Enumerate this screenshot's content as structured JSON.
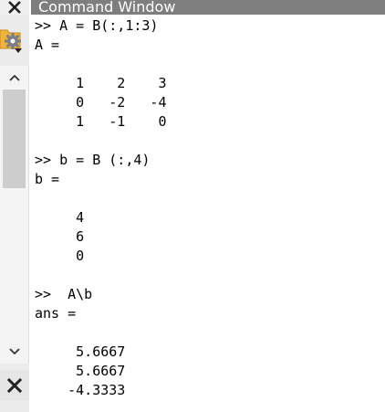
{
  "window": {
    "title": "Command Window"
  },
  "icons": {
    "close_top": "close-icon",
    "gear": "gear-icon",
    "folder": "folder-icon",
    "scroll_up": "chevron-up-icon",
    "scroll_down": "chevron-down-icon",
    "close_bottom": "close-icon"
  },
  "colors": {
    "titlebar_bg": "#7e7e7e",
    "titlebar_text": "#ffffff",
    "folder": "#f0b43c"
  },
  "console": {
    "lines": [
      ">> A = B(:,1:3)",
      "A =",
      "",
      "     1    2    3",
      "     0   -2   -4",
      "     1   -1    0",
      "",
      ">> b = B (:,4)",
      "b =",
      "",
      "     4",
      "     6",
      "     0",
      "",
      ">>  A\\b",
      "ans =",
      "",
      "     5.6667",
      "     5.6667",
      "    -4.3333"
    ]
  }
}
